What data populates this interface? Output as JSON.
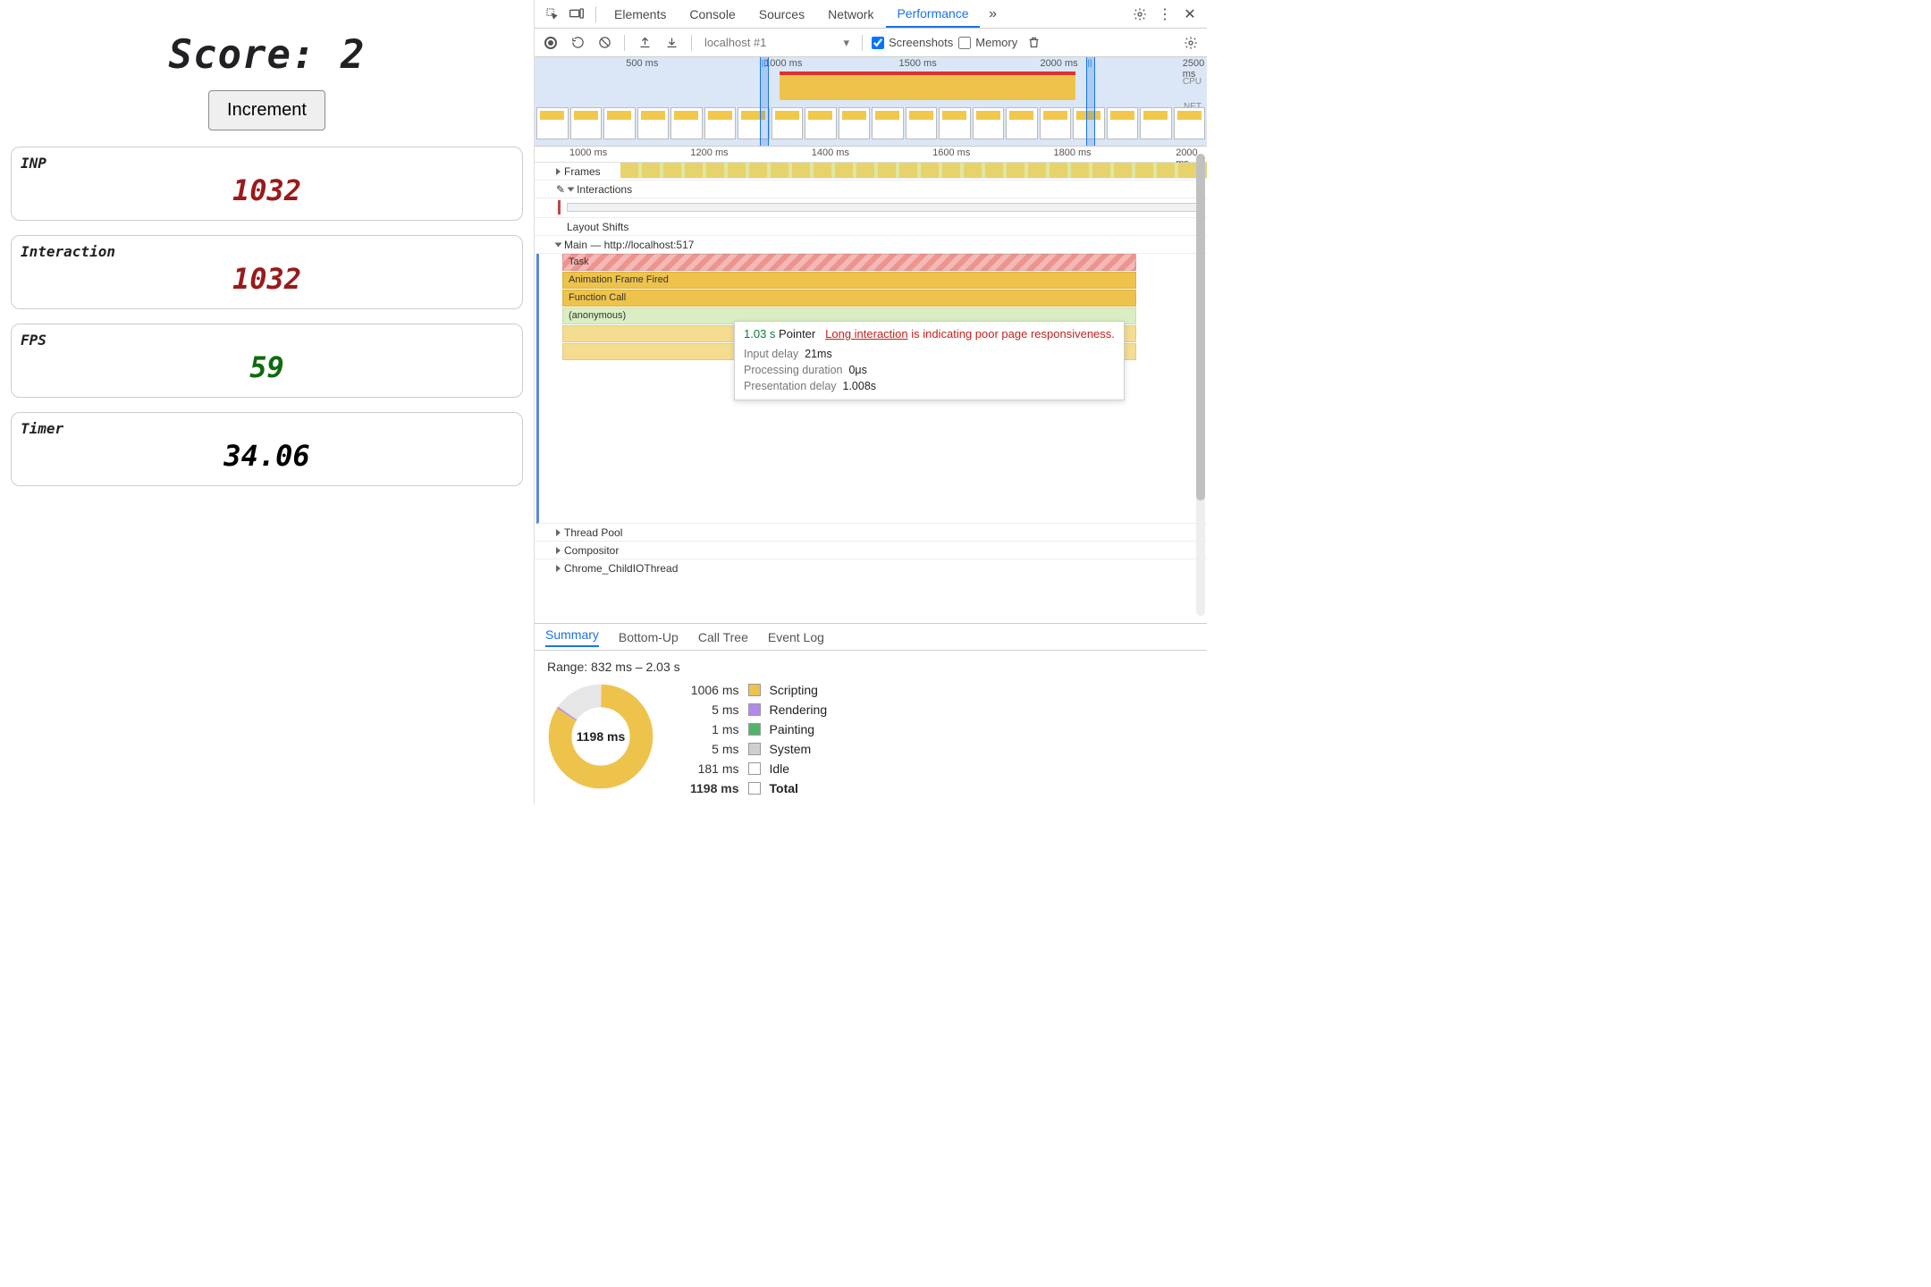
{
  "app": {
    "score_prefix": "Score: ",
    "score_value": "2",
    "increment_label": "Increment",
    "metrics": {
      "inp": {
        "label": "INP",
        "value": "1032"
      },
      "interaction": {
        "label": "Interaction",
        "value": "1032"
      },
      "fps": {
        "label": "FPS",
        "value": "59"
      },
      "timer": {
        "label": "Timer",
        "value": "34.06"
      }
    }
  },
  "devtools": {
    "tabs": {
      "elements": "Elements",
      "console": "Console",
      "sources": "Sources",
      "network": "Network",
      "performance": "Performance"
    },
    "toolbar": {
      "recording": "localhost #1",
      "screenshots_label": "Screenshots",
      "memory_label": "Memory"
    },
    "overview_ticks": {
      "t500": "500 ms",
      "t1000": "1000 ms",
      "t1500": "1500 ms",
      "t2000": "2000 ms",
      "t2500": "2500 ms",
      "cpu": "CPU",
      "net": "NET"
    },
    "flame_ticks": {
      "t1000": "1000 ms",
      "t1200": "1200 ms",
      "t1400": "1400 ms",
      "t1600": "1600 ms",
      "t1800": "1800 ms",
      "t2000": "2000 ms"
    },
    "tracks": {
      "frames": "Frames",
      "interactions": "Interactions",
      "layout_shifts": "Layout Shifts",
      "main": "Main — http://localhost:517",
      "task": "Task",
      "aff": "Animation Frame Fired",
      "fcall": "Function Call",
      "anon": "(anonymous)",
      "thread_pool": "Thread Pool",
      "compositor": "Compositor",
      "child_io": "Chrome_ChildIOThread"
    },
    "tooltip": {
      "time": "1.03 s",
      "pointer": "Pointer",
      "link": "Long interaction",
      "rest": " is indicating poor page responsiveness.",
      "input_delay_k": "Input delay",
      "input_delay_v": "21ms",
      "proc_k": "Processing duration",
      "proc_v": "0μs",
      "pres_k": "Presentation delay",
      "pres_v": "1.008s"
    },
    "bottom_tabs": {
      "summary": "Summary",
      "bottom_up": "Bottom-Up",
      "call_tree": "Call Tree",
      "event_log": "Event Log"
    },
    "summary": {
      "range": "Range: 832 ms – 2.03 s",
      "center": "1198 ms",
      "rows": {
        "scripting": {
          "t": "1006 ms",
          "name": "Scripting",
          "color": "#eec34b"
        },
        "rendering": {
          "t": "5 ms",
          "name": "Rendering",
          "color": "#b388eb"
        },
        "painting": {
          "t": "1 ms",
          "name": "Painting",
          "color": "#54b36a"
        },
        "system": {
          "t": "5 ms",
          "name": "System",
          "color": "#cfcfcf"
        },
        "idle": {
          "t": "181 ms",
          "name": "Idle",
          "color": "#ffffff"
        },
        "total": {
          "t": "1198 ms",
          "name": "Total"
        }
      }
    }
  }
}
